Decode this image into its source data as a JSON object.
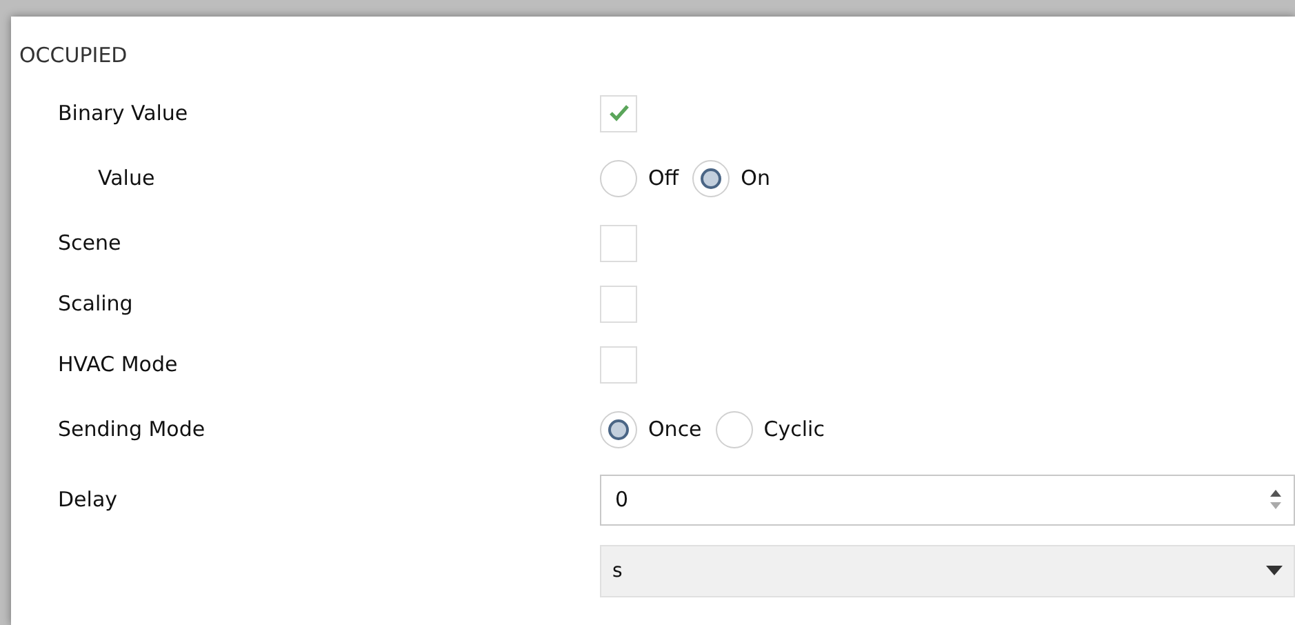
{
  "section": {
    "title": "OCCUPIED"
  },
  "rows": [
    {
      "kind": "checkbox",
      "label": "Binary Value",
      "checked": true,
      "children": [
        {
          "kind": "radio",
          "label": "Value",
          "options": [
            {
              "label": "Off",
              "selected": false
            },
            {
              "label": "On",
              "selected": true
            }
          ]
        }
      ]
    },
    {
      "kind": "checkbox",
      "label": "Scene",
      "checked": false
    },
    {
      "kind": "checkbox",
      "label": "Scaling",
      "checked": false
    },
    {
      "kind": "checkbox",
      "label": "HVAC Mode",
      "checked": false
    },
    {
      "kind": "radio",
      "label": "Sending Mode",
      "options": [
        {
          "label": "Once",
          "selected": true
        },
        {
          "label": "Cyclic",
          "selected": false
        }
      ]
    },
    {
      "kind": "number",
      "label": "Delay",
      "value": "0"
    },
    {
      "kind": "select",
      "value": "s"
    }
  ]
}
